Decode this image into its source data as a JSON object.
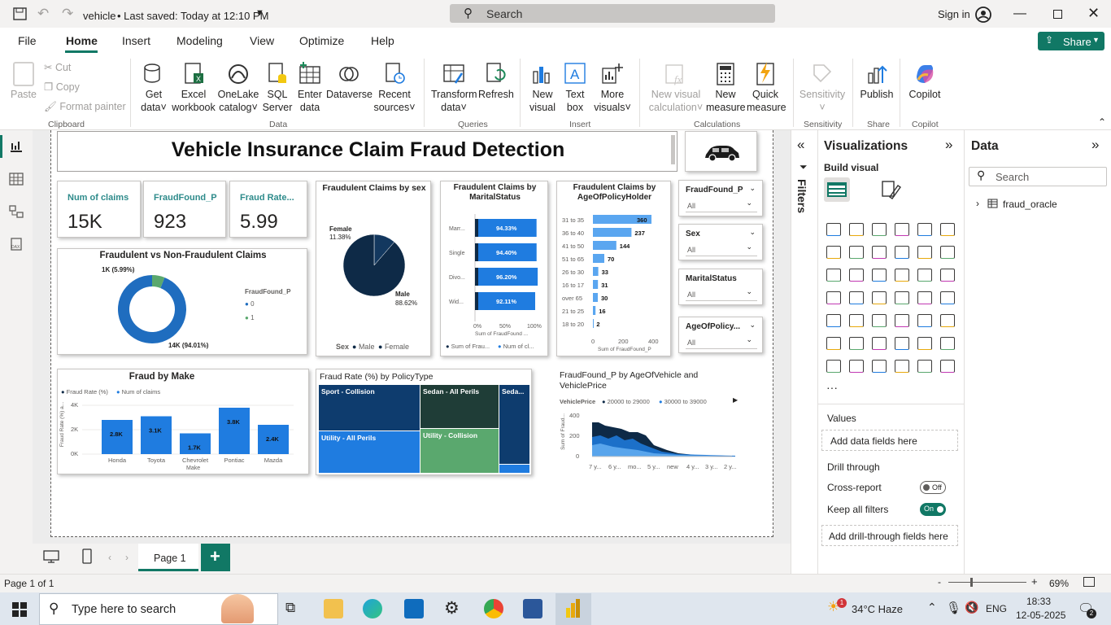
{
  "title_bar": {
    "file_name": "vehicle",
    "saved": "• Last saved: Today at 12:10 PM",
    "search_label": "Search",
    "sign_in": "Sign in"
  },
  "menu": {
    "items": [
      "File",
      "Home",
      "Insert",
      "Modeling",
      "View",
      "Optimize",
      "Help"
    ],
    "active": "Home",
    "share": "Share"
  },
  "ribbon": {
    "clipboard": {
      "paste": "Paste",
      "cut": "Cut",
      "copy": "Copy",
      "format_painter": "Format painter",
      "group": "Clipboard"
    },
    "data": {
      "get_data": [
        "Get",
        "data"
      ],
      "excel": [
        "Excel",
        "workbook"
      ],
      "onelake": [
        "OneLake",
        "catalog"
      ],
      "sql": [
        "SQL",
        "Server"
      ],
      "enter": [
        "Enter",
        "data"
      ],
      "dataverse": "Dataverse",
      "recent": [
        "Recent",
        "sources"
      ],
      "group": "Data"
    },
    "queries": {
      "transform": [
        "Transform",
        "data"
      ],
      "refresh": "Refresh",
      "group": "Queries"
    },
    "insert": {
      "new_visual": [
        "New",
        "visual"
      ],
      "text_box": [
        "Text",
        "box"
      ],
      "more": [
        "More",
        "visuals"
      ],
      "group": "Insert"
    },
    "calculations": {
      "new_calc": [
        "New visual",
        "calculation"
      ],
      "new_measure": [
        "New",
        "measure"
      ],
      "quick": [
        "Quick",
        "measure"
      ],
      "group": "Calculations"
    },
    "sensitivity": {
      "label": "Sensitivity",
      "group": "Sensitivity"
    },
    "share": {
      "publish": "Publish",
      "group": "Share"
    },
    "copilot": {
      "label": "Copilot",
      "group": "Copilot"
    }
  },
  "report": {
    "title": "Vehicle Insurance Claim Fraud Detection",
    "kpis": [
      {
        "label": "Num of claims",
        "value": "15K"
      },
      {
        "label": "FraudFound_P",
        "value": "923"
      },
      {
        "label": "Fraud Rate...",
        "value": "5.99"
      }
    ],
    "donut": {
      "title": "Fraudulent vs Non-Fraudulent Claims",
      "legend_title": "FraudFound_P",
      "legend": [
        "0",
        "1"
      ],
      "label_small": "1K (5.99%)",
      "label_big": "14K (94.01%)"
    },
    "sex": {
      "title": "Fraudulent Claims by sex",
      "female_label": "Female",
      "female_pct": "11.38%",
      "male_label": "Male",
      "male_pct": "88.62%",
      "legend_title": "Sex",
      "legend": [
        "Male",
        "Female"
      ]
    },
    "marital": {
      "title": "Fraudulent Claims by MaritalStatus",
      "ticks": [
        "0%",
        "50%",
        "100%"
      ],
      "axis": "Sum of FraudFound ...",
      "legend": [
        "Sum of Frau...",
        "Num of cl..."
      ]
    },
    "age": {
      "title": "Fraudulent Claims by AgeOfPolicyHolder",
      "ticks": [
        "0",
        "200",
        "400"
      ],
      "axis": "Sum of FraudFound_P"
    },
    "slicers": [
      {
        "title": "FraudFound_P",
        "value": "All"
      },
      {
        "title": "Sex",
        "value": "All"
      },
      {
        "title": "MaritalStatus",
        "value": "All"
      },
      {
        "title": "AgeOfPolicy...",
        "value": "All"
      }
    ],
    "make": {
      "title": "Fraud by Make",
      "legend": [
        "Fraud Rate (%)",
        "Num of claims"
      ],
      "yticks": [
        "4K",
        "2K",
        "0K"
      ],
      "ylabel": "Fraud Rate (%) a...",
      "xlabel": "Make"
    },
    "treemap": {
      "title": "Fraud Rate (%) by PolicyType",
      "tiles": [
        "Sport - Collision",
        "Sedan - All Perils",
        "Seda...",
        "Utility - All Perils",
        "Utility - Collision"
      ]
    },
    "area": {
      "title": "FraudFound_P by AgeOfVehicle and VehiclePrice",
      "legend_title": "VehiclePrice",
      "legend": [
        "20000 to 29000",
        "30000 to 39000"
      ],
      "yticks": [
        "400",
        "200",
        "0"
      ],
      "ylabel": "Sum of Fraud...",
      "xticks": [
        "7 y...",
        "6 y...",
        "mo...",
        "5 y...",
        "new",
        "4 y...",
        "3 y...",
        "2 y..."
      ]
    }
  },
  "chart_data": [
    {
      "type": "pie",
      "title": "Fraudulent vs Non-Fraudulent Claims",
      "categories": [
        "0",
        "1"
      ],
      "values": [
        94.01,
        5.99
      ]
    },
    {
      "type": "pie",
      "title": "Fraudulent Claims by sex",
      "categories": [
        "Male",
        "Female"
      ],
      "values": [
        88.62,
        11.38
      ]
    },
    {
      "type": "bar",
      "title": "Fraudulent Claims by MaritalStatus",
      "categories": [
        "Marr...",
        "Single",
        "Divo...",
        "Wid..."
      ],
      "values": [
        94.33,
        94.4,
        96.2,
        92.11
      ],
      "labels": [
        "94.33%",
        "94.40%",
        "96.20%",
        "92.11%"
      ],
      "xlim": [
        0,
        100
      ]
    },
    {
      "type": "bar",
      "title": "Fraudulent Claims by AgeOfPolicyHolder",
      "categories": [
        "31 to 35",
        "36 to 40",
        "41 to 50",
        "51 to 65",
        "26 to 30",
        "16 to 17",
        "over 65",
        "21 to 25",
        "18 to 20"
      ],
      "values": [
        360,
        237,
        144,
        70,
        33,
        31,
        30,
        16,
        2
      ],
      "xlim": [
        0,
        400
      ]
    },
    {
      "type": "bar",
      "title": "Fraud by Make",
      "categories": [
        "Honda",
        "Toyota",
        "Chevrolet",
        "Pontiac",
        "Mazda"
      ],
      "values": [
        2.8,
        3.1,
        1.7,
        3.8,
        2.4
      ],
      "labels": [
        "2.8K",
        "3.1K",
        "1.7K",
        "3.8K",
        "2.4K"
      ],
      "ylim": [
        0,
        4
      ]
    }
  ],
  "filters_label": "Filters",
  "viz_pane": {
    "title": "Visualizations",
    "build": "Build visual",
    "values": "Values",
    "add_data": "Add data fields here",
    "drill": "Drill through",
    "cross": "Cross-report",
    "cross_state": "Off",
    "keep": "Keep all filters",
    "keep_state": "On",
    "add_drill": "Add drill-through fields here"
  },
  "data_pane": {
    "title": "Data",
    "search": "Search",
    "table": "fraud_oracle"
  },
  "pages": {
    "tab": "Page 1"
  },
  "status": {
    "page": "Page 1 of 1",
    "zoom": "69%"
  },
  "taskbar": {
    "search": "Type here to search",
    "weather": "34°C  Haze",
    "lang": "ENG",
    "time": "18:33",
    "date": "12-05-2025",
    "badge": "1",
    "notif": "2"
  },
  "colors": {
    "accent": "#117865",
    "dark": "#0e2a47",
    "blue": "#1f7ce0",
    "lightblue": "#3899f2",
    "green": "#5aa86e"
  }
}
